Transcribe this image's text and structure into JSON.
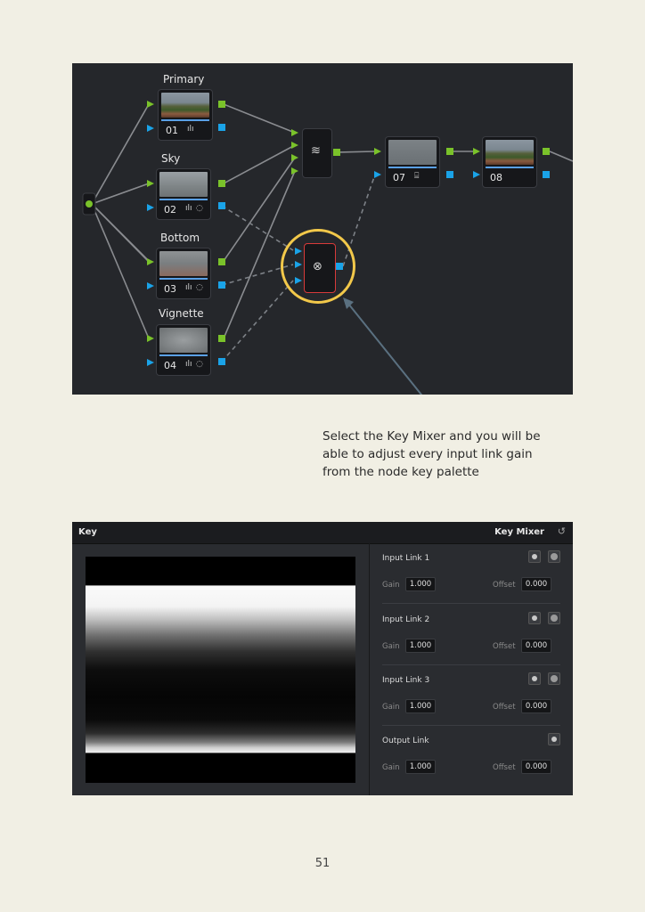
{
  "node_graph": {
    "labels": {
      "primary": "Primary",
      "sky": "Sky",
      "bottom": "Bottom",
      "vignette": "Vignette"
    },
    "nodes": [
      {
        "number": "01",
        "thumb": "scene"
      },
      {
        "number": "02",
        "thumb": "sky"
      },
      {
        "number": "03",
        "thumb": "bottom"
      },
      {
        "number": "04",
        "thumb": "vig"
      },
      {
        "number": "07",
        "thumb": "fog"
      },
      {
        "number": "08",
        "thumb": "scene"
      }
    ],
    "colors": {
      "rgb_link": "#7ac22a",
      "key_link": "#1aa3e8",
      "highlight": "#f2c84a",
      "selected_border": "#d83a3a"
    }
  },
  "caption": "Select the Key Mixer and you will be able to adjust every input link gain from the node key palette",
  "key_panel": {
    "title": "Key",
    "mode": "Key Mixer",
    "links": [
      {
        "name": "Input Link 1",
        "gain_label": "Gain",
        "gain": "1.000",
        "offset_label": "Offset",
        "offset": "0.000"
      },
      {
        "name": "Input Link 2",
        "gain_label": "Gain",
        "gain": "1.000",
        "offset_label": "Offset",
        "offset": "0.000"
      },
      {
        "name": "Input Link 3",
        "gain_label": "Gain",
        "gain": "1.000",
        "offset_label": "Offset",
        "offset": "0.000"
      },
      {
        "name": "Output Link",
        "gain_label": "Gain",
        "gain": "1.000",
        "offset_label": "Offset",
        "offset": "0.000"
      }
    ]
  },
  "page_number": "51"
}
